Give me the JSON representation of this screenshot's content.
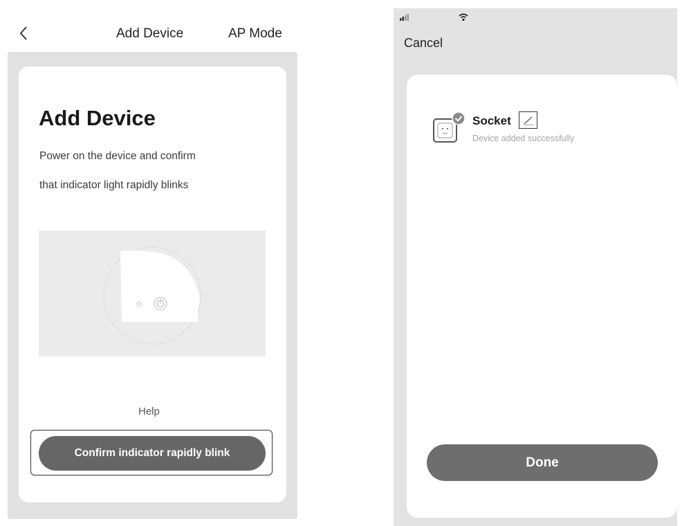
{
  "left": {
    "nav": {
      "back_icon": "chevron-left-icon",
      "title": "Add Device",
      "mode_label": "AP Mode"
    },
    "card": {
      "heading": "Add Device",
      "instruction_line1": "Power on the device and confirm",
      "instruction_line2": "that indicator light rapidly blinks",
      "illustration_icon": "socket-power-icon",
      "help_label": "Help",
      "confirm_label": "Confirm indicator rapidly blink"
    }
  },
  "right": {
    "status_bar": {
      "signal_icon": "signal-icon",
      "wifi_icon": "wifi-icon"
    },
    "cancel_label": "Cancel",
    "device": {
      "icon": "socket-icon",
      "name": "Socket",
      "edit_icon": "pencil-icon",
      "status": "Device added successfully"
    },
    "done_label": "Done"
  },
  "colors": {
    "button_gray": "#666666",
    "backdrop_gray": "#e1e1e1",
    "illustration_gray": "#ebebeb",
    "status_gray": "#a6a6a6"
  }
}
